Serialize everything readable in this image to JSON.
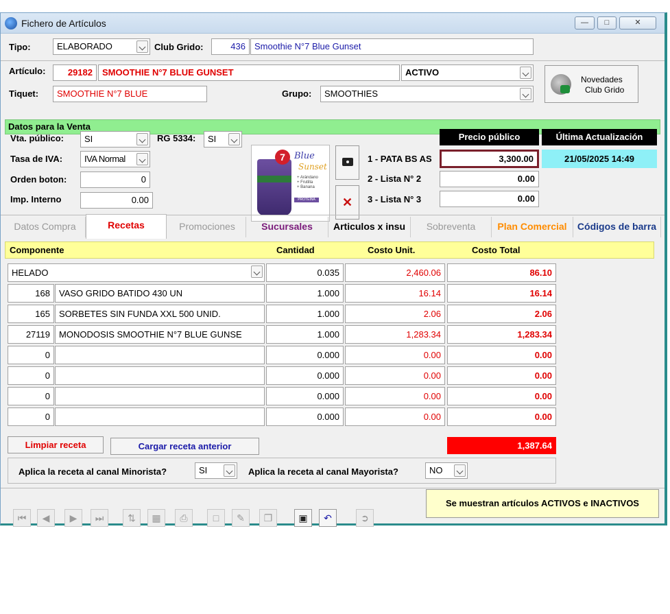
{
  "window": {
    "title": "Fichero de Artículos"
  },
  "header": {
    "tipo_label": "Tipo:",
    "tipo_value": "ELABORADO",
    "club_label": "Club Grido:",
    "club_code": "436",
    "club_name": "Smoothie N°7 Blue Gunset",
    "articulo_label": "Artículo:",
    "articulo_code": "29182",
    "articulo_name": "SMOOTHIE N°7 BLUE GUNSET",
    "estado_value": "ACTIVO",
    "tiquet_label": "Tiquet:",
    "tiquet_value": "SMOOTHIE N°7 BLUE",
    "grupo_label": "Grupo:",
    "grupo_value": "SMOOTHIES",
    "novedades_label_1": "Novedades",
    "novedades_label_2": "Club Grido"
  },
  "venta": {
    "section_title": "Datos para la Venta",
    "vta_publico_label": "Vta. público:",
    "vta_publico_value": "SI",
    "rg_label": "RG 5334:",
    "rg_value": "SI",
    "tasa_iva_label": "Tasa de IVA:",
    "tasa_iva_value": "IVA Normal",
    "orden_boton_label": "Orden boton:",
    "orden_boton_value": "0",
    "imp_interno_label": "Imp. Interno",
    "imp_interno_value": "0.00",
    "precio_publico_header": "Precio público",
    "ultima_act_header": "Última Actualización",
    "ultima_act_value": "21/05/2025 14:49",
    "listas": [
      {
        "label": "1 - PATA BS AS",
        "value": "3,300.00"
      },
      {
        "label": "2 - Lista N° 2",
        "value": "0.00"
      },
      {
        "label": "3 - Lista N° 3",
        "value": "0.00"
      }
    ]
  },
  "product_image": {
    "number": "7",
    "brand_1": "Blue",
    "brand_2": "Sunset",
    "items": [
      "+ Arándano",
      "+ Frutilla",
      "+ Banana"
    ],
    "tag": "PROTEÍNA"
  },
  "tabs": [
    {
      "label": "Datos Compra"
    },
    {
      "label": "Recetas"
    },
    {
      "label": "Promociones"
    },
    {
      "label": "Sucursales"
    },
    {
      "label": "Articulos x insu"
    },
    {
      "label": "Sobreventa"
    },
    {
      "label": "Plan Comercial"
    },
    {
      "label": "Códigos de barra"
    }
  ],
  "receta": {
    "columns": {
      "componente": "Componente",
      "cantidad": "Cantidad",
      "costo_unit": "Costo Unit.",
      "costo_total": "Costo Total"
    },
    "rows": [
      {
        "code": "",
        "name": "HELADO",
        "cantidad": "0.035",
        "costo_unit": "2,460.06",
        "costo_total": "86.10"
      },
      {
        "code": "168",
        "name": "VASO GRIDO BATIDO 430 UN",
        "cantidad": "1.000",
        "costo_unit": "16.14",
        "costo_total": "16.14"
      },
      {
        "code": "165",
        "name": "SORBETES SIN FUNDA XXL 500 UNID.",
        "cantidad": "1.000",
        "costo_unit": "2.06",
        "costo_total": "2.06"
      },
      {
        "code": "27119",
        "name": "MONODOSIS SMOOTHIE N°7 BLUE GUNSE",
        "cantidad": "1.000",
        "costo_unit": "1,283.34",
        "costo_total": "1,283.34"
      },
      {
        "code": "0",
        "name": "",
        "cantidad": "0.000",
        "costo_unit": "0.00",
        "costo_total": "0.00"
      },
      {
        "code": "0",
        "name": "",
        "cantidad": "0.000",
        "costo_unit": "0.00",
        "costo_total": "0.00"
      },
      {
        "code": "0",
        "name": "",
        "cantidad": "0.000",
        "costo_unit": "0.00",
        "costo_total": "0.00"
      },
      {
        "code": "0",
        "name": "",
        "cantidad": "0.000",
        "costo_unit": "0.00",
        "costo_total": "0.00"
      }
    ],
    "total": "1,387.64",
    "limpiar_label": "Limpiar receta",
    "cargar_label": "Cargar receta anterior",
    "minorista_label": "Aplica la receta al canal Minorista?",
    "minorista_value": "SI",
    "mayorista_label": "Aplica la receta al canal Mayorista?",
    "mayorista_value": "NO"
  },
  "status": {
    "message": "Se muestran artículos ACTIVOS e INACTIVOS"
  },
  "colors": {
    "accent_green": "#90ee90",
    "header_yellow": "#ffff99",
    "total_red": "#ff0000",
    "price_border": "#7a1f2b"
  }
}
